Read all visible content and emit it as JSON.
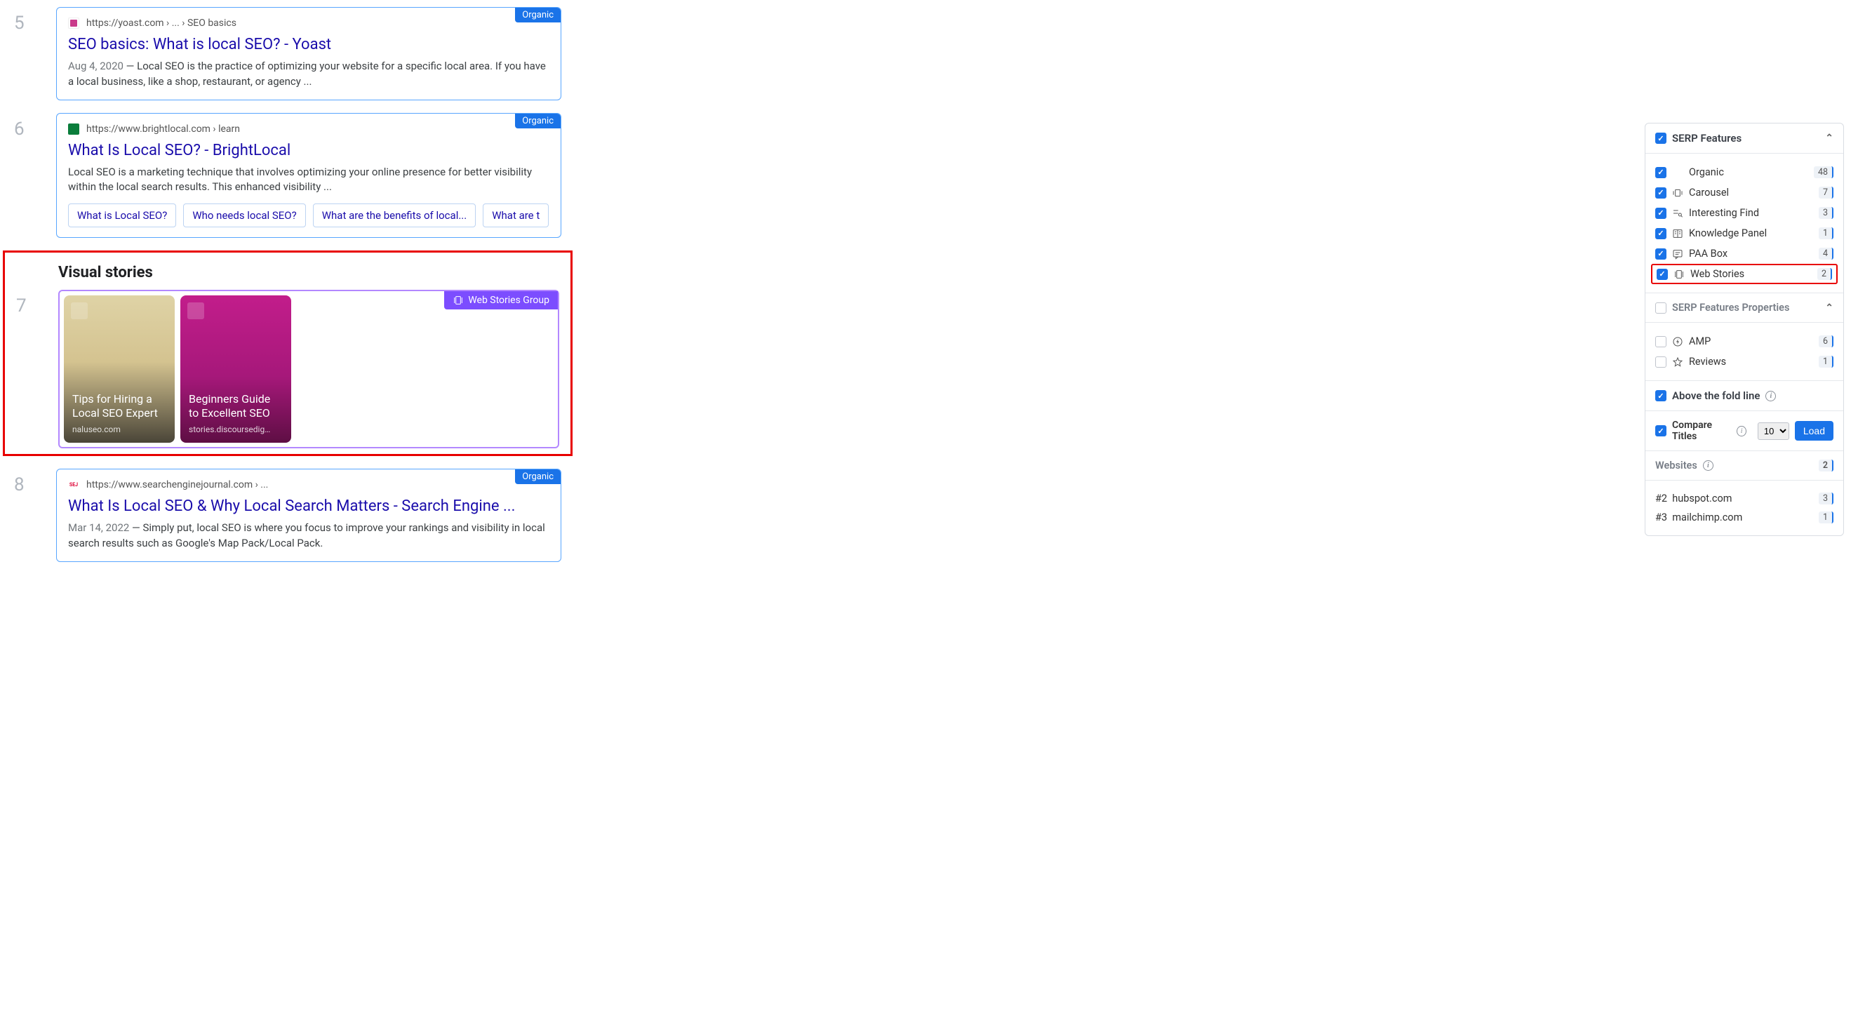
{
  "results": [
    {
      "rank": "5",
      "badge": "Organic",
      "url": "https://yoast.com › ... › SEO basics",
      "favicon_color": "#c93a8a",
      "title": "SEO basics: What is local SEO? - Yoast",
      "date": "Aug 4, 2020",
      "desc": "Local SEO is the practice of optimizing your website for a specific local area. If you have a local business, like a shop, restaurant, or agency ..."
    },
    {
      "rank": "6",
      "badge": "Organic",
      "url": "https://www.brightlocal.com › learn",
      "favicon_color": "#0a7d3b",
      "title": "What Is Local SEO? - BrightLocal",
      "date": "",
      "desc": "Local SEO is a marketing technique that involves optimizing your online presence for better visibility within the local search results. This enhanced visibility ...",
      "chips": [
        "What is Local SEO?",
        "Who needs local SEO?",
        "What are the benefits of local...",
        "What are t"
      ]
    }
  ],
  "visual_stories": {
    "heading": "Visual stories",
    "rank": "7",
    "badge": "Web Stories Group",
    "items": [
      {
        "title": "Tips for Hiring a Local SEO Expert",
        "domain": "naluseo.com",
        "cls": "tan"
      },
      {
        "title": "Beginners Guide to Excellent SEO",
        "domain": "stories.discoursedig…",
        "cls": "magenta"
      }
    ]
  },
  "result8": {
    "rank": "8",
    "badge": "Organic",
    "url": "https://www.searchenginejournal.com › ...",
    "favicon_text": "SEJ",
    "title": "What Is Local SEO & Why Local Search Matters - Search Engine ...",
    "date": "Mar 14, 2022",
    "desc": "Simply put, local SEO is where you focus to improve your rankings and visibility in local search results such as Google's Map Pack/Local Pack."
  },
  "sidebar": {
    "serp_features_title": "SERP Features",
    "features": [
      {
        "label": "Organic",
        "count": "48",
        "icon": ""
      },
      {
        "label": "Carousel",
        "count": "7",
        "icon": "carousel"
      },
      {
        "label": "Interesting Find",
        "count": "3",
        "icon": "find"
      },
      {
        "label": "Knowledge Panel",
        "count": "1",
        "icon": "panel"
      },
      {
        "label": "PAA Box",
        "count": "4",
        "icon": "paa"
      },
      {
        "label": "Web Stories",
        "count": "2",
        "icon": "stories",
        "highlight": true
      }
    ],
    "props_title": "SERP Features Properties",
    "props": [
      {
        "label": "AMP",
        "count": "6",
        "icon": "amp"
      },
      {
        "label": "Reviews",
        "count": "1",
        "icon": "star"
      }
    ],
    "above_fold": "Above the fold line",
    "compare_titles": "Compare Titles",
    "compare_count": "10",
    "load_label": "Load",
    "websites_title": "Websites",
    "websites_count": "2",
    "websites": [
      {
        "rank": "#2",
        "domain": "hubspot.com",
        "count": "3"
      },
      {
        "rank": "#3",
        "domain": "mailchimp.com",
        "count": "1"
      }
    ]
  }
}
